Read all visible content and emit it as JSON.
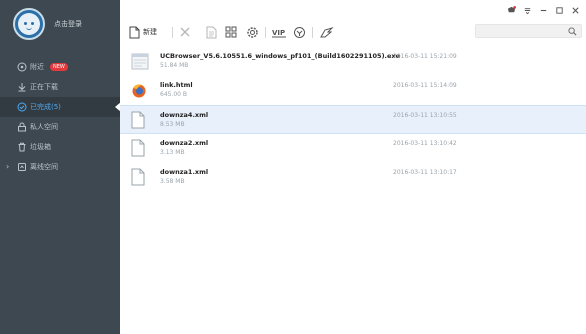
{
  "sidebar": {
    "login_label": "点击登录",
    "items": [
      {
        "label": "附近",
        "badge": "NEW",
        "icon": "location-icon"
      },
      {
        "label": "正在下载",
        "icon": "download-icon"
      },
      {
        "label": "已完成(5)",
        "icon": "check-circle-icon"
      },
      {
        "label": "私人空间",
        "icon": "lock-icon"
      },
      {
        "label": "垃圾箱",
        "icon": "trash-icon"
      },
      {
        "label": "离线空间",
        "icon": "cloud-icon"
      }
    ]
  },
  "toolbar": {
    "new_label": "新建"
  },
  "files": [
    {
      "name": "UCBrowser_V5.6.10551.6_windows_pf101_(Build1602291105).exe",
      "size": "51.84 MB",
      "date": "2016-03-11 15:21:09",
      "icon": "exe-icon"
    },
    {
      "name": "link.html",
      "size": "645.00 B",
      "date": "2016-03-11 15:14:09",
      "icon": "firefox-icon"
    },
    {
      "name": "downza4.xml",
      "size": "8.53 MB",
      "date": "2016-03-11 13:10:55",
      "icon": "file-icon"
    },
    {
      "name": "downza2.xml",
      "size": "3.13 MB",
      "date": "2016-03-11 13:10:42",
      "icon": "file-icon"
    },
    {
      "name": "downza1.xml",
      "size": "3.58 MB",
      "date": "2016-03-11 13:10:17",
      "icon": "file-icon"
    }
  ],
  "colors": {
    "sidebar_bg": "#3e4850",
    "active_accent": "#4ea8ee",
    "badge_red": "#e4393c",
    "selected_row": "#e8f1fb"
  }
}
